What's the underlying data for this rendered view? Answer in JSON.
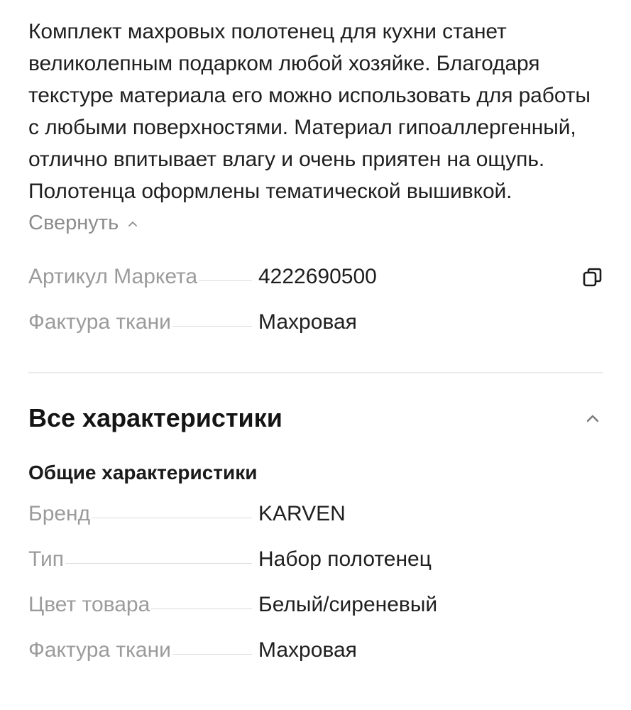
{
  "description": {
    "text": "Комплект махровых полотенец для кухни станет великолепным подарком любой хозяйке. Благодаря текстуре материала его можно использовать для работы с любыми поверхностями. Материал гипоаллергенный, отлично впитывает влагу и очень приятен на ощупь. Полотенца оформлены тематической вышивкой.",
    "collapse_label": "Свернуть"
  },
  "brief_specs": [
    {
      "key": "Артикул Маркета",
      "value": "4222690500"
    },
    {
      "key": "Фактура ткани",
      "value": "Махровая"
    }
  ],
  "all_specs": {
    "title": "Все характеристики",
    "groups": [
      {
        "title": "Общие характеристики",
        "rows": [
          {
            "key": "Бренд",
            "value": "KARVEN"
          },
          {
            "key": "Тип",
            "value": "Набор полотенец"
          },
          {
            "key": "Цвет товара",
            "value": "Белый/сиреневый"
          },
          {
            "key": "Фактура ткани",
            "value": "Махровая"
          }
        ]
      }
    ]
  },
  "icons": {
    "copy": "copy-icon",
    "collapse": "chevron-up-icon",
    "section_toggle": "chevron-up-icon"
  }
}
